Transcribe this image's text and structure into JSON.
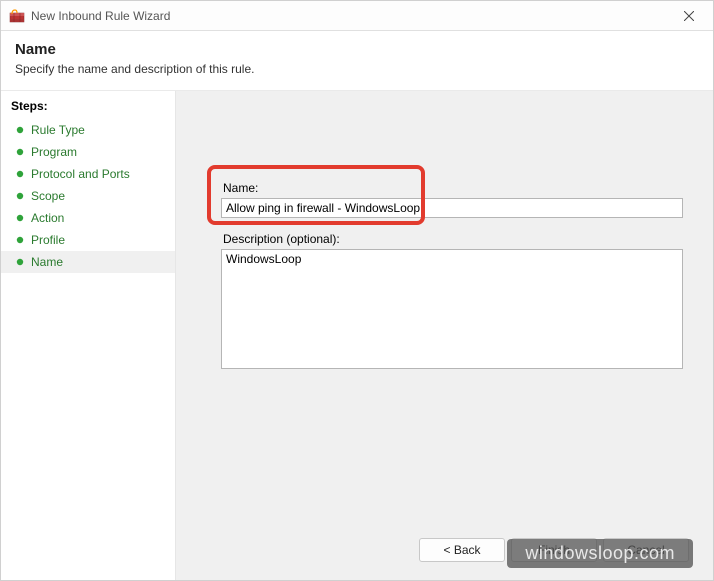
{
  "titlebar": {
    "title": "New Inbound Rule Wizard"
  },
  "header": {
    "title": "Name",
    "subtitle": "Specify the name and description of this rule."
  },
  "sidebar": {
    "title": "Steps:",
    "items": [
      {
        "label": "Rule Type"
      },
      {
        "label": "Program"
      },
      {
        "label": "Protocol and Ports"
      },
      {
        "label": "Scope"
      },
      {
        "label": "Action"
      },
      {
        "label": "Profile"
      },
      {
        "label": "Name"
      }
    ],
    "currentIndex": 6
  },
  "form": {
    "name_label": "Name:",
    "name_value": "Allow ping in firewall - WindowsLoop",
    "desc_label": "Description (optional):",
    "desc_value": "WindowsLoop"
  },
  "buttons": {
    "back": "< Back",
    "finish": "Finish",
    "cancel": "Cancel"
  },
  "watermark": "windowsloop.com"
}
